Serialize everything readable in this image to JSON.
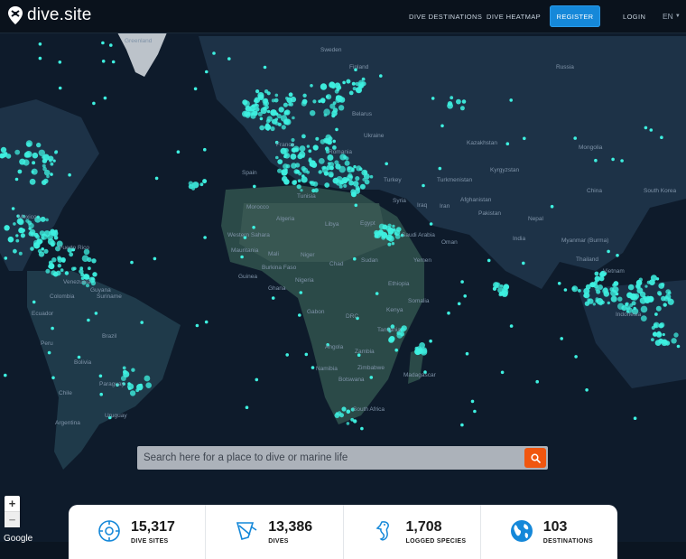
{
  "header": {
    "logo_text": "dive.site",
    "nav_destinations": "DIVE DESTINATIONS",
    "nav_heatmap": "DIVE HEATMAP",
    "register": "REGISTER",
    "login": "LOGIN",
    "language": "EN"
  },
  "map": {
    "attribution": "Google",
    "labels": [
      "Greenland",
      "Sweden",
      "Finland",
      "Russia",
      "Belarus",
      "Ukraine",
      "Kazakhstan",
      "Mongolia",
      "Kyrgyzstan",
      "Turkmenistan",
      "Turkey",
      "Syria",
      "Iraq",
      "Iran",
      "Afghanistan",
      "Pakistan",
      "China",
      "South Korea",
      "Nepal",
      "India",
      "Myanmar (Burma)",
      "Thailand",
      "Vietnam",
      "Indonesia",
      "Morocco",
      "Algeria",
      "Libya",
      "Egypt",
      "Saudi Arabia",
      "Oman",
      "Yemen",
      "Sudan",
      "Chad",
      "Niger",
      "Mali",
      "Mauritania",
      "Western Sahara",
      "Burkina Faso",
      "Guinea",
      "Nigeria",
      "Ghana",
      "Ethiopia",
      "Somalia",
      "Kenya",
      "Tanzania",
      "DRC",
      "Gabon",
      "Angola",
      "Zambia",
      "Namibia",
      "Botswana",
      "Zimbabwe",
      "Madagascar",
      "South Africa",
      "Mexico",
      "Puerto Rico",
      "Venezuela",
      "Guyana",
      "Suriname",
      "Colombia",
      "Ecuador",
      "Peru",
      "Brazil",
      "Bolivia",
      "Paraguay",
      "Chile",
      "Argentina",
      "Uruguay",
      "France",
      "Spain",
      "Tunisia",
      "Romania"
    ],
    "hotspot_color": "#3ef0e0",
    "land_color": "#1d3247",
    "ocean_color": "#0e1b2b"
  },
  "search": {
    "placeholder": "Search here for a place to dive or marine life",
    "button_icon": "search-icon"
  },
  "zoom": {
    "in": "+",
    "out": "−"
  },
  "stats": [
    {
      "value": "15,317",
      "label": "DIVE SITES",
      "icon": "dive-site-pin-icon"
    },
    {
      "value": "13,386",
      "label": "DIVES",
      "icon": "dive-flag-icon"
    },
    {
      "value": "1,708",
      "label": "LOGGED SPECIES",
      "icon": "seahorse-icon"
    },
    {
      "value": "103",
      "label": "DESTINATIONS",
      "icon": "globe-icon"
    }
  ]
}
